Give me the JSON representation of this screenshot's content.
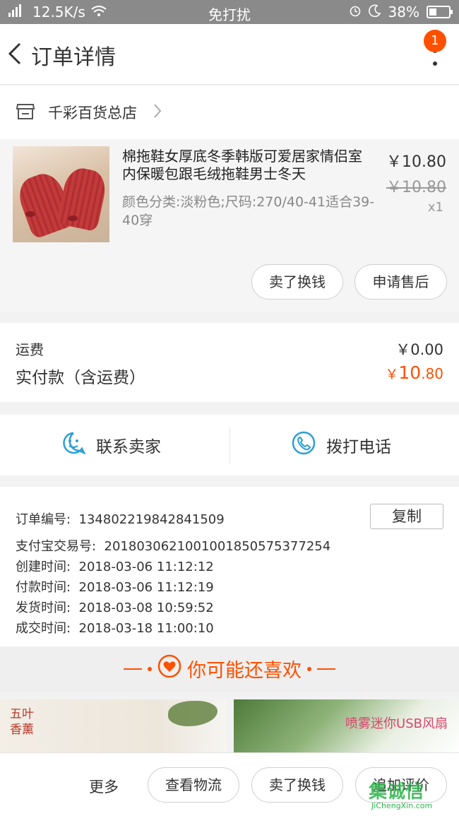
{
  "status_bar": {
    "signal": "4G",
    "speed": "12.5K/s",
    "mode": "免打扰",
    "battery_pct": "38%",
    "battery_level": 0.38
  },
  "nav": {
    "title": "订单详情",
    "badge": "1"
  },
  "store": {
    "name": "千彩百货总店"
  },
  "product": {
    "title": "棉拖鞋女厚底冬季韩版可爱居家情侣室内保暖包跟毛绒拖鞋男士冬天",
    "spec": "颜色分类:淡粉色;尺码:270/40-41适合39-40穿",
    "price": "￥10.80",
    "original_price": "￥10.80",
    "qty": "x1",
    "buttons": [
      "卖了换钱",
      "申请售后"
    ]
  },
  "fees": {
    "shipping_label": "运费",
    "shipping_value": "￥0.00",
    "paid_label": "实付款（含运费）",
    "paid_symbol": "￥",
    "paid_int": "10",
    "paid_dec": ".80"
  },
  "contact": {
    "seller": "联系卖家",
    "call": "拨打电话"
  },
  "order_info": {
    "order_no_label": "订单编号:",
    "order_no": "134802219842841509",
    "copy": "复制",
    "alipay_label": "支付宝交易号:",
    "alipay_no": "2018030621001001850575377254",
    "created_label": "创建时间:",
    "created": "2018-03-06 11:12:12",
    "paid_label": "付款时间:",
    "paid": "2018-03-06 11:12:19",
    "shipped_label": "发货时间:",
    "shipped": "2018-03-08 10:59:52",
    "done_label": "成交时间:",
    "done": "2018-03-18 11:00:10"
  },
  "guess": {
    "title": "你可能还喜欢"
  },
  "recommendations": {
    "item1_tag": "五叶香薰",
    "item2_label": "喷雾迷你USB风扇"
  },
  "bottom_bar": {
    "more": "更多",
    "buttons": [
      "查看物流",
      "卖了换钱",
      "追加评价"
    ]
  },
  "watermark": {
    "logo": "集诚信",
    "site": "JiChengXin.com"
  },
  "colors": {
    "accent": "#ff5000",
    "blue_icon": "#2a9fd6"
  }
}
